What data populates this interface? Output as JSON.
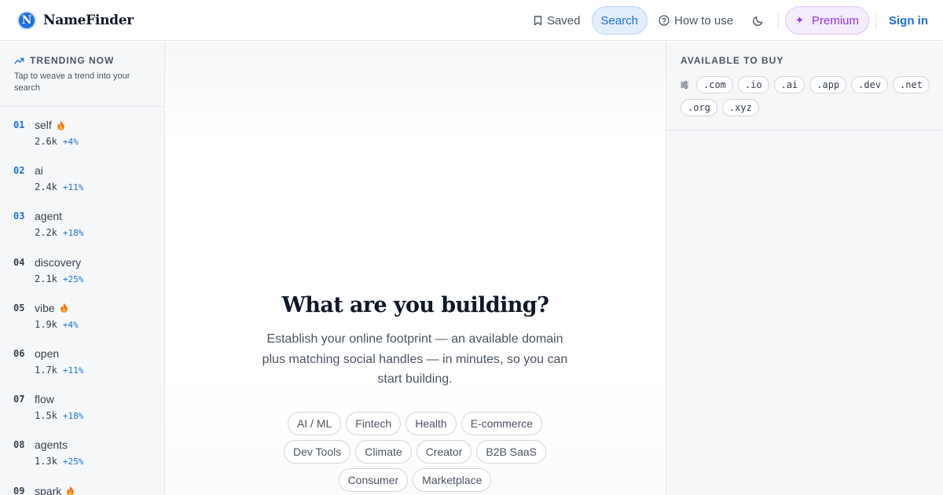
{
  "brand": {
    "logo_letter": "N",
    "name": "NameFinder",
    "accent": "#1d6fe0"
  },
  "nav": {
    "saved": {
      "label": "Saved",
      "icon": "bookmark-icon"
    },
    "search": {
      "label": "Search"
    },
    "how_to_use": {
      "label": "How to use",
      "icon": "help-circle-icon"
    },
    "theme": {
      "icon": "moon-icon"
    },
    "premium": {
      "label": "Premium",
      "icon": "sparkle-icon",
      "glyph": "✦",
      "color": "#9333ea"
    },
    "sign_in": {
      "label": "Sign in"
    }
  },
  "sidebar": {
    "title": "TRENDING NOW",
    "title_icon": "trending-up-icon",
    "subtitle": "Tap to weave a trend into your search",
    "trends": [
      {
        "rank": "01",
        "word": "self",
        "count": "2.6k",
        "change": "+4%",
        "hot": true
      },
      {
        "rank": "02",
        "word": "ai",
        "count": "2.4k",
        "change": "+11%",
        "hot": false
      },
      {
        "rank": "03",
        "word": "agent",
        "count": "2.2k",
        "change": "+18%",
        "hot": false
      },
      {
        "rank": "04",
        "word": "discovery",
        "count": "2.1k",
        "change": "+25%",
        "hot": false
      },
      {
        "rank": "05",
        "word": "vibe",
        "count": "1.9k",
        "change": "+4%",
        "hot": true
      },
      {
        "rank": "06",
        "word": "open",
        "count": "1.7k",
        "change": "+11%",
        "hot": false
      },
      {
        "rank": "07",
        "word": "flow",
        "count": "1.5k",
        "change": "+18%",
        "hot": false
      },
      {
        "rank": "08",
        "word": "agents",
        "count": "1.3k",
        "change": "+25%",
        "hot": false
      },
      {
        "rank": "09",
        "word": "spark",
        "count": "",
        "change": "",
        "hot": true
      }
    ]
  },
  "main": {
    "title": "What are you building?",
    "description": "Establish your online footprint — an available domain plus matching social handles — in minutes, so you can start building.",
    "categories": [
      "AI / ML",
      "Fintech",
      "Health",
      "E-commerce",
      "Dev Tools",
      "Climate",
      "Creator",
      "B2B SaaS",
      "Consumer",
      "Marketplace"
    ]
  },
  "right_panel": {
    "title": "AVAILABLE TO BUY",
    "filter_icon": "sliders-icon",
    "tlds": [
      ".com",
      ".io",
      ".ai",
      ".app",
      ".dev",
      ".net",
      ".org",
      ".xyz"
    ]
  }
}
